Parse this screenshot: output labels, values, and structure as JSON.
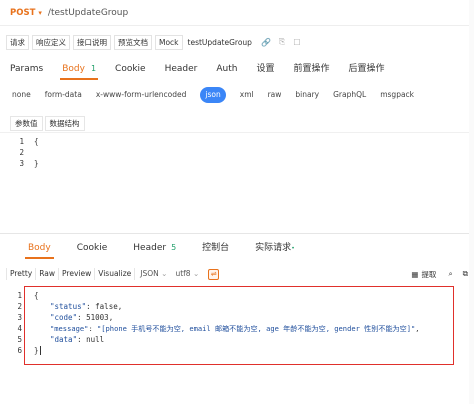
{
  "request": {
    "method": "POST",
    "url": "/testUpdateGroup"
  },
  "tool_tabs": [
    "请求",
    "响应定义",
    "接口说明",
    "预览文档",
    "Mock",
    "testUpdateGroup"
  ],
  "request_tabs": [
    {
      "label": "Params"
    },
    {
      "label": "Body",
      "count": "1"
    },
    {
      "label": "Cookie"
    },
    {
      "label": "Header"
    },
    {
      "label": "Auth"
    },
    {
      "label": "设置"
    },
    {
      "label": "前置操作"
    },
    {
      "label": "后置操作"
    }
  ],
  "body_types": [
    "none",
    "form-data",
    "x-www-form-urlencoded",
    "json",
    "xml",
    "raw",
    "binary",
    "GraphQL",
    "msgpack"
  ],
  "active_body_type": "json",
  "sub_tabs": [
    "参数值",
    "数据结构"
  ],
  "request_editor": {
    "lines": [
      "{",
      "",
      "}"
    ],
    "line_numbers": [
      "1",
      "2",
      "3"
    ]
  },
  "response_tabs": [
    {
      "label": "Body"
    },
    {
      "label": "Cookie"
    },
    {
      "label": "Header",
      "count": "5"
    },
    {
      "label": "控制台"
    },
    {
      "label": "实际请求",
      "dot": "•"
    }
  ],
  "response_toolbar": {
    "buttons": [
      "Pretty",
      "Raw",
      "Preview",
      "Visualize"
    ],
    "format": "JSON",
    "encoding": "utf8",
    "extract_label": "提取"
  },
  "response_body": {
    "line_numbers": [
      "1",
      "2",
      "3",
      "4",
      "5",
      "6"
    ],
    "open": "{",
    "fields": [
      {
        "key": "\"status\"",
        "value": "false",
        "comma": ","
      },
      {
        "key": "\"code\"",
        "value": "51003",
        "comma": ","
      },
      {
        "key": "\"message\"",
        "value": "\"[phone 手机号不能为空, email 邮箱不能为空, age 年龄不能为空, gender 性别不能为空]\"",
        "comma": ","
      },
      {
        "key": "\"data\"",
        "value": "null",
        "comma": ""
      }
    ],
    "close": "}"
  },
  "colors": {
    "accent": "#e8721c",
    "json_pill": "#3b86f7",
    "count_green": "#22a06b",
    "highlight_box": "#e0302b"
  }
}
